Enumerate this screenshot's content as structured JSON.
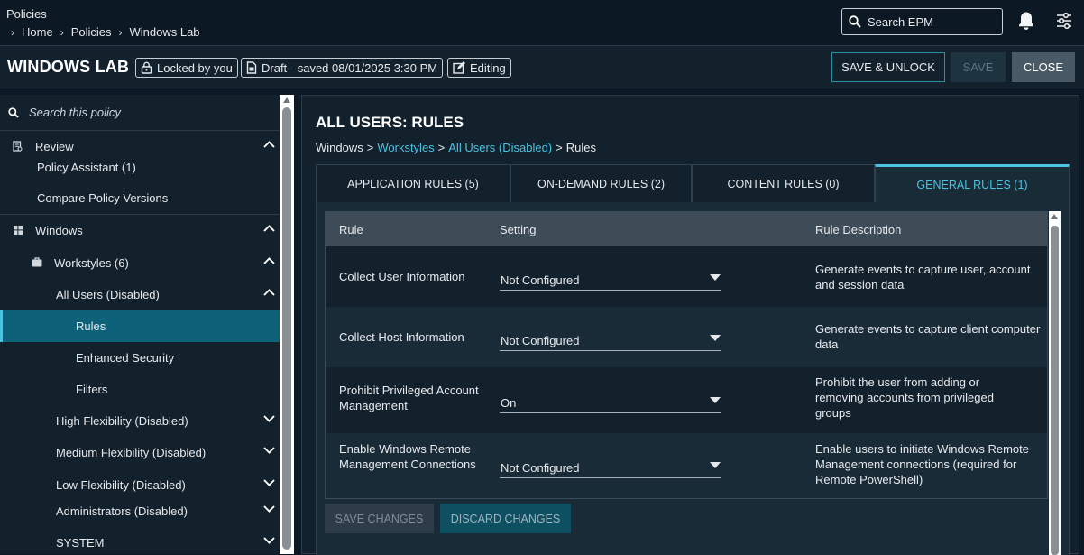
{
  "header": {
    "app_title": "Policies",
    "breadcrumb": [
      "Home",
      "Policies",
      "Windows Lab"
    ],
    "search_placeholder": "Search EPM",
    "icons": [
      "search-icon",
      "bell-icon",
      "filter-settings-icon"
    ]
  },
  "titlebar": {
    "policy_name": "WINDOWS LAB",
    "locked_label": "Locked by you",
    "draft_label": "Draft - saved 08/01/2025 3:30 PM",
    "editing_label": "Editing",
    "save_unlock_label": "SAVE & UNLOCK",
    "save_label": "SAVE",
    "close_label": "CLOSE"
  },
  "sidebar": {
    "search_placeholder": "Search this policy",
    "review": {
      "label": "Review",
      "items": [
        "Policy Assistant (1)",
        "Compare Policy Versions"
      ]
    },
    "windows": {
      "label": "Windows",
      "workstyles": "Workstyles (6)",
      "all_users": "All Users (Disabled)",
      "all_users_children": [
        "Rules",
        "Enhanced Security",
        "Filters"
      ],
      "other_workstyles": [
        "High Flexibility (Disabled)",
        "Medium Flexibility (Disabled)",
        "Low Flexibility (Disabled)",
        "Administrators (Disabled)",
        "SYSTEM"
      ]
    },
    "active_item": "Rules"
  },
  "main": {
    "title": "ALL USERS: RULES",
    "crumb": {
      "root": "Windows",
      "sep": ">",
      "workstyles": "Workstyles",
      "all_users": "All Users (Disabled)",
      "current": "Rules"
    },
    "tabs": [
      {
        "label": "APPLICATION RULES (5)"
      },
      {
        "label": "ON-DEMAND RULES (2)"
      },
      {
        "label": "CONTENT RULES (0)"
      },
      {
        "label": "GENERAL RULES (1)"
      }
    ],
    "active_tab": "GENERAL RULES (1)",
    "columns": [
      "Rule",
      "Setting",
      "Rule Description"
    ],
    "rows": [
      {
        "rule": "Collect User Information",
        "setting": "Not Configured",
        "description": "Generate events to capture user, account and session data"
      },
      {
        "rule": "Collect Host Information",
        "setting": "Not Configured",
        "description": "Generate events to capture client computer data"
      },
      {
        "rule": "Prohibit Privileged Account Management",
        "setting": "On",
        "description": "Prohibit the user from adding or removing accounts from privileged groups"
      },
      {
        "rule": "Enable Windows Remote Management Connections",
        "setting": "Not Configured",
        "description": "Enable users to initiate Windows Remote Management connections (required for Remote PowerShell)"
      }
    ],
    "save_changes_label": "SAVE CHANGES",
    "discard_changes_label": "DISCARD CHANGES"
  },
  "colors": {
    "background": "#0c1823",
    "panel": "#13212d",
    "accent": "#4cc3e0",
    "active_item": "#0d6178",
    "table_header": "#3e4c58"
  }
}
